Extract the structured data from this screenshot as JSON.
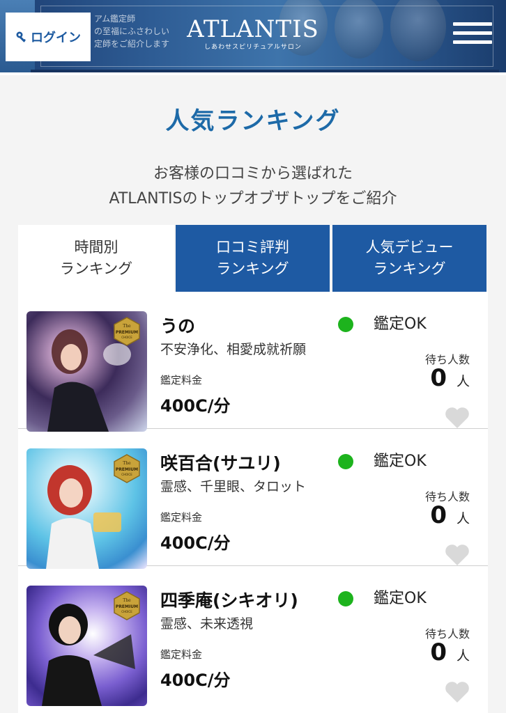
{
  "header": {
    "login_label": "ログイン",
    "logo": "ATLANTIS",
    "logo_sub": "しあわせスピリチュアルサロン",
    "banner_copy": [
      "アム鑑定師",
      "の至福にふさわしい",
      "定師をご紹介します"
    ]
  },
  "page_title": "人気ランキング",
  "intro": {
    "line1": "お客様の口コミから選ばれた",
    "line2": "ATLANTISのトップオブザトップをご紹介"
  },
  "tabs": [
    {
      "line1": "時間別",
      "line2": "ランキング",
      "active": true
    },
    {
      "line1": "口コミ評判",
      "line2": "ランキング",
      "active": false
    },
    {
      "line1": "人気デビュー",
      "line2": "ランキング",
      "active": false
    }
  ],
  "fortune_tellers": [
    {
      "name": "うの",
      "tags": "不安浄化、相愛成就祈願",
      "fee_label": "鑑定料金",
      "fee": "400C/分",
      "status": "鑑定OK",
      "wait_label": "待ち人数",
      "wait_count": "0",
      "wait_unit": "人"
    },
    {
      "name": "咲百合(サユリ)",
      "tags": "霊感、千里眼、タロット",
      "fee_label": "鑑定料金",
      "fee": "400C/分",
      "status": "鑑定OK",
      "wait_label": "待ち人数",
      "wait_count": "0",
      "wait_unit": "人"
    },
    {
      "name": "四季庵(シキオリ)",
      "tags": "霊感、未来透視",
      "fee_label": "鑑定料金",
      "fee": "400C/分",
      "status": "鑑定OK",
      "wait_label": "待ち人数",
      "wait_count": "0",
      "wait_unit": "人"
    }
  ],
  "badge_text": {
    "the": "The",
    "premium": "PREMIUM",
    "choice": "CHOICE"
  },
  "colors": {
    "accent": "#1d6aa8",
    "tab_blue": "#1e5aa3",
    "status_green": "#1db31d",
    "badge_gold": "#c9a33a"
  },
  "icons": [
    "key-icon",
    "hamburger-menu-icon",
    "premium-badge-icon",
    "status-dot-icon",
    "heart-icon"
  ]
}
